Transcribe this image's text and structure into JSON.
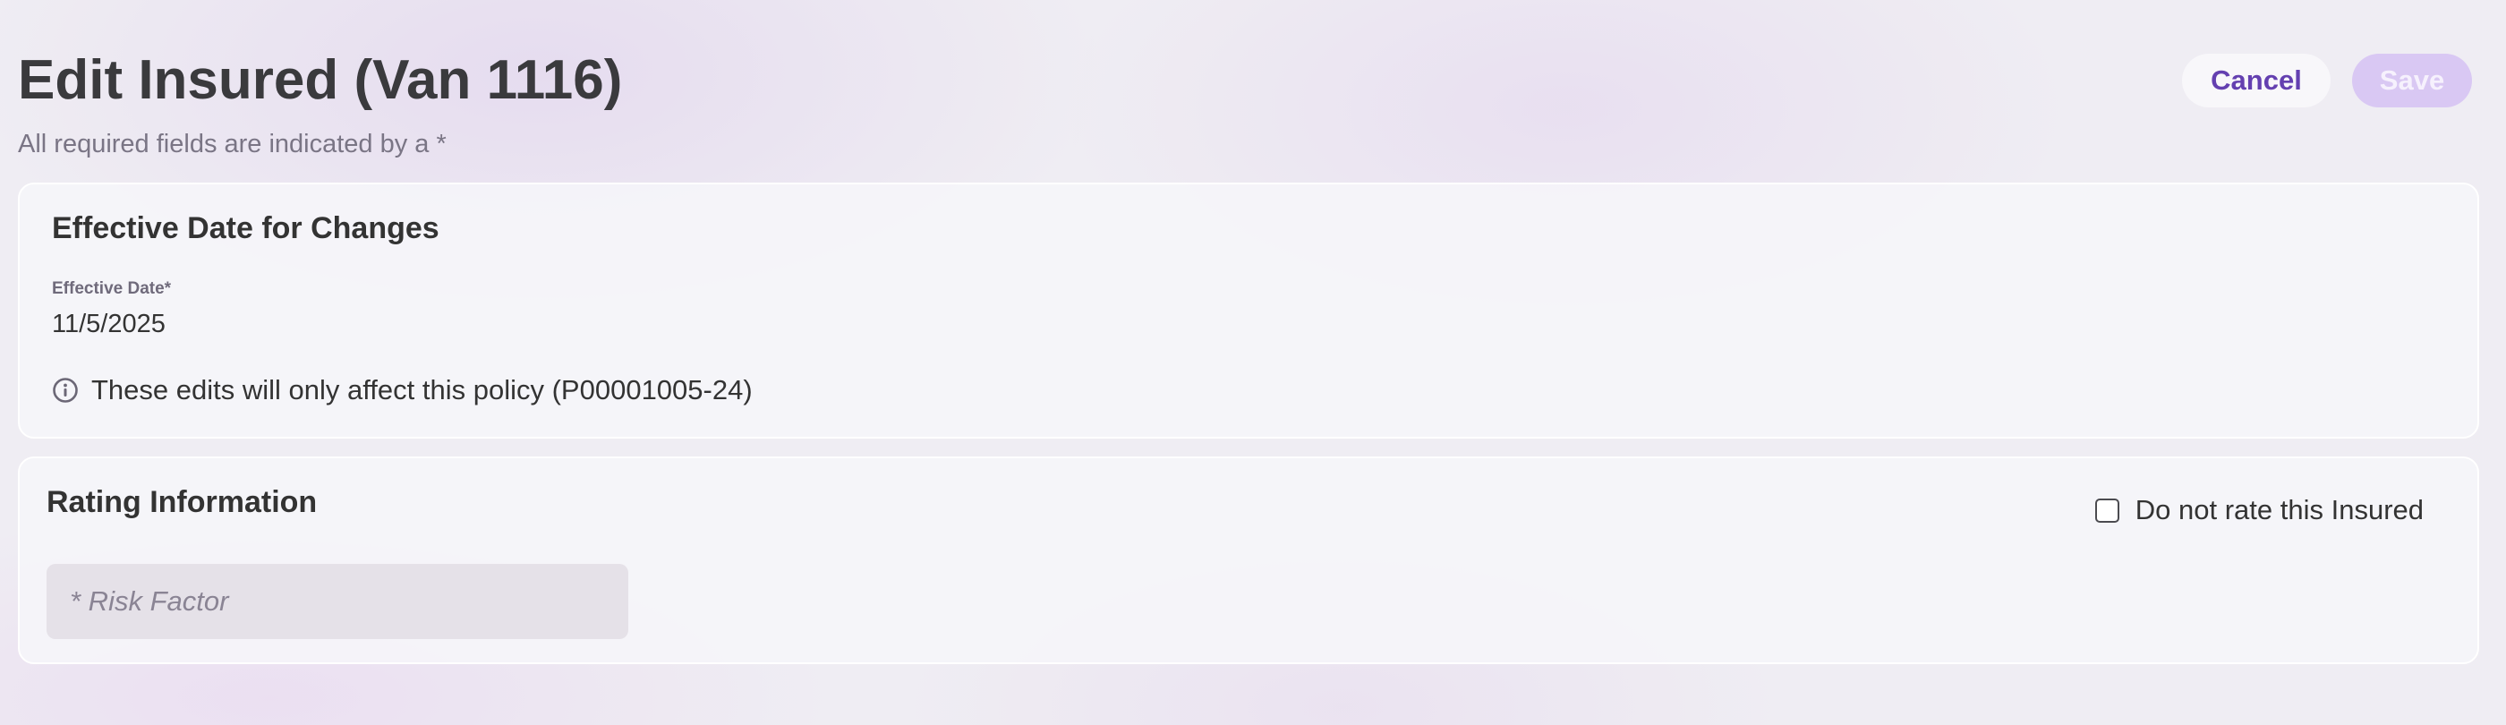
{
  "header": {
    "title": "Edit Insured (Van 1116)",
    "subtitle": "All required fields are indicated by a *",
    "cancel_label": "Cancel",
    "save_label": "Save"
  },
  "effective_section": {
    "title": "Effective Date for Changes",
    "field_label": "Effective Date*",
    "field_value": "11/5/2025",
    "info_text": "These edits will only affect this policy (P00001005-24)",
    "info_icon": "info-circle-icon"
  },
  "rating_section": {
    "title": "Rating Information",
    "checkbox_label": "Do not rate this Insured",
    "checkbox_checked": false,
    "risk_factor_placeholder": "* Risk Factor",
    "risk_factor_value": ""
  },
  "colors": {
    "accent": "#6440b0",
    "save_disabled_bg": "#d9c8f3",
    "page_bg": "#efedf3"
  }
}
